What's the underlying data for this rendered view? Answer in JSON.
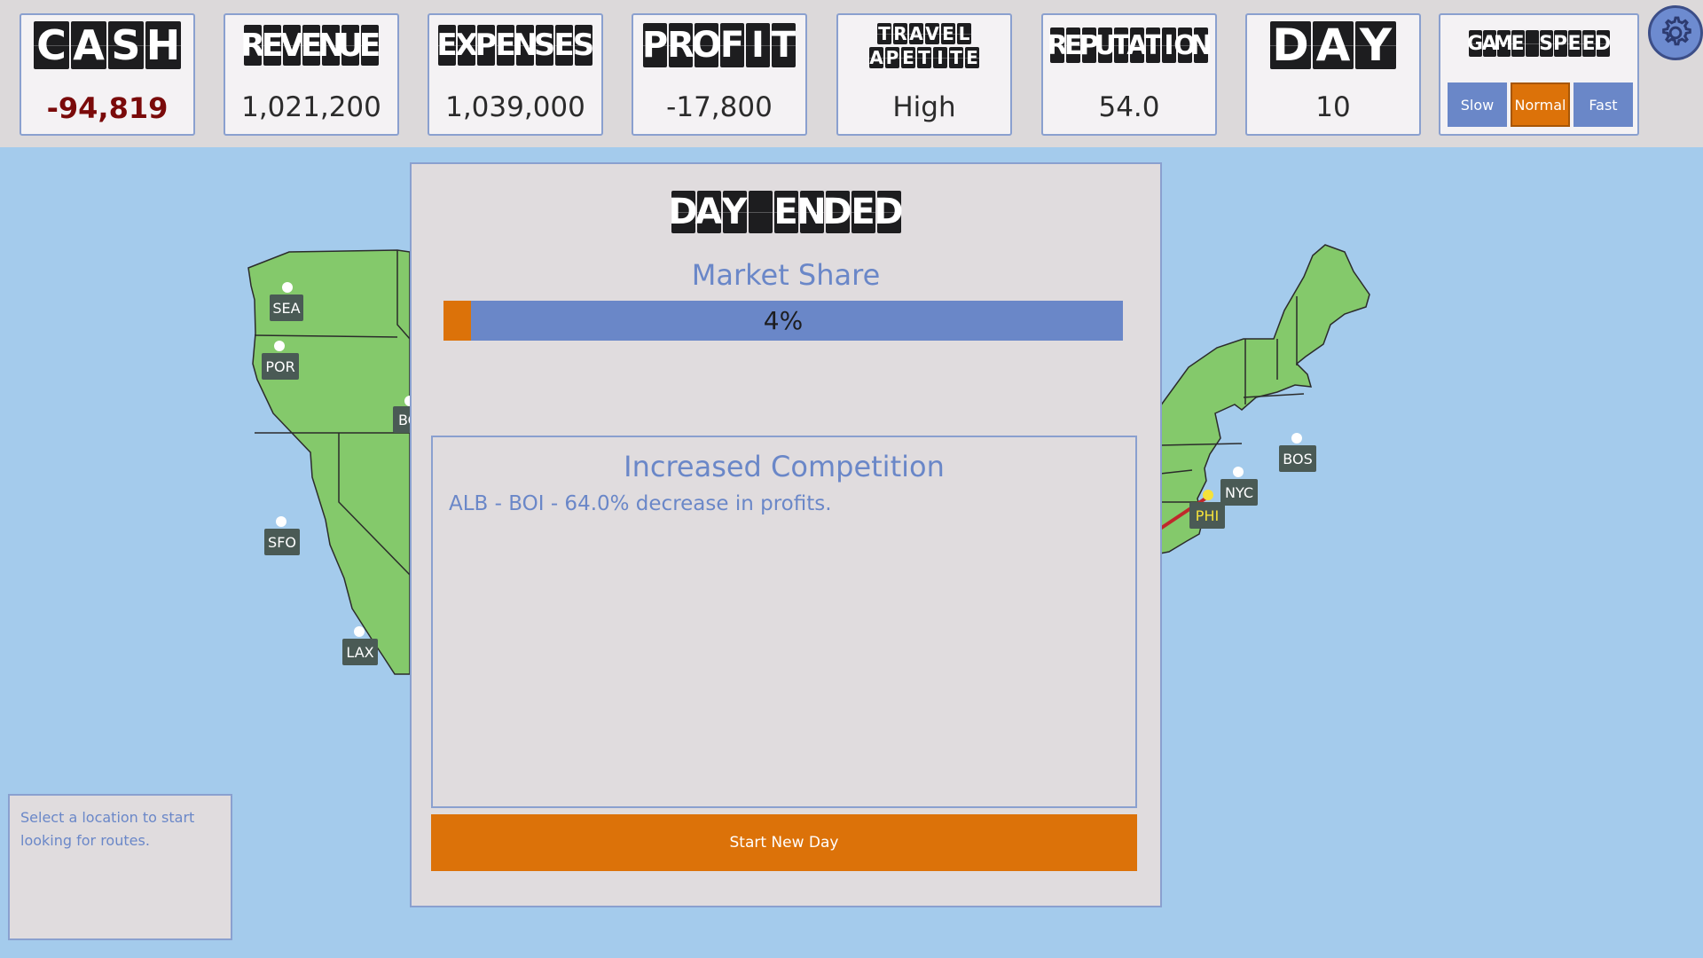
{
  "stats": [
    {
      "id": "cash",
      "title": "CASH",
      "value": "-94,819",
      "negative": true
    },
    {
      "id": "revenue",
      "title": "REVENUE",
      "value": "1,021,200"
    },
    {
      "id": "expenses",
      "title": "EXPENSES",
      "value": "1,039,000"
    },
    {
      "id": "profit",
      "title": "PROFIT",
      "value": "-17,800"
    },
    {
      "id": "travel",
      "title_lines": [
        "TRAVEL",
        "APETITE"
      ],
      "value": "High"
    },
    {
      "id": "reputation",
      "title": "REPUTATION",
      "value": "54.0"
    },
    {
      "id": "day",
      "title": "DAY",
      "value": "10"
    }
  ],
  "game_speed": {
    "title": "GAME SPEED",
    "options": [
      "Slow",
      "Normal",
      "Fast"
    ],
    "selected": "Normal"
  },
  "settings_icon": "gear-icon",
  "cities": [
    "SEA",
    "POR",
    "BOI",
    "SFO",
    "LAX",
    "NYC",
    "PHI",
    "BOS"
  ],
  "active_route": {
    "from": "BOI",
    "to": "PHI"
  },
  "info_box": {
    "text": "Select a location to start looking for routes."
  },
  "modal": {
    "title": "DAY ENDED",
    "market_share_label": "Market Share",
    "market_share_percent": 4,
    "market_share_text": "4%",
    "event_title": "Increased Competition",
    "event_text": "ALB - BOI - 64.0% decrease in profits.",
    "button_label": "Start New Day"
  },
  "colors": {
    "accent_blue": "#6a87c8",
    "accent_orange": "#dc7209",
    "land": "#84c96b",
    "water": "#a4cbec",
    "negative": "#7a0a0a",
    "route": "#c0282b"
  }
}
